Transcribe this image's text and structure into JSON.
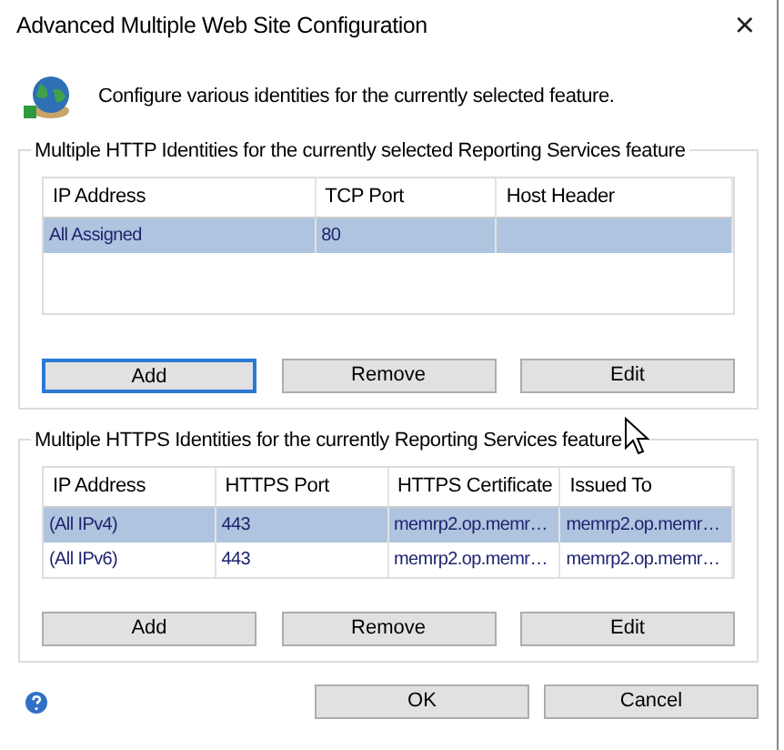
{
  "window": {
    "title": "Advanced Multiple Web Site Configuration",
    "close": "×"
  },
  "intro": "Configure various identities for the currently selected feature.",
  "groups": [
    {
      "legend": "Multiple HTTP Identities for the currently selected Reporting Services feature",
      "columns": [
        "IP Address",
        "TCP Port",
        "Host Header"
      ],
      "rows": [
        {
          "cells": [
            "All Assigned",
            "80",
            ""
          ],
          "selected": true
        }
      ],
      "buttons": [
        {
          "label": "Add",
          "focused": true
        },
        {
          "label": "Remove",
          "focused": false
        },
        {
          "label": "Edit",
          "focused": false
        }
      ]
    },
    {
      "legend": "Multiple HTTPS Identities for the currently Reporting Services feature",
      "columns": [
        "IP Address",
        "HTTPS Port",
        "HTTPS Certificate",
        "Issued To"
      ],
      "rows": [
        {
          "cells": [
            "(All IPv4)",
            "443",
            "memrp2.op.memr…",
            "memrp2.op.memr…"
          ],
          "selected": true
        },
        {
          "cells": [
            "(All IPv6)",
            "443",
            "memrp2.op.memr…",
            "memrp2.op.memr…"
          ],
          "selected": false
        }
      ],
      "buttons": [
        {
          "label": "Add",
          "focused": false
        },
        {
          "label": "Remove",
          "focused": false
        },
        {
          "label": "Edit",
          "focused": false
        }
      ]
    }
  ],
  "footer_buttons": [
    "OK",
    "Cancel"
  ]
}
